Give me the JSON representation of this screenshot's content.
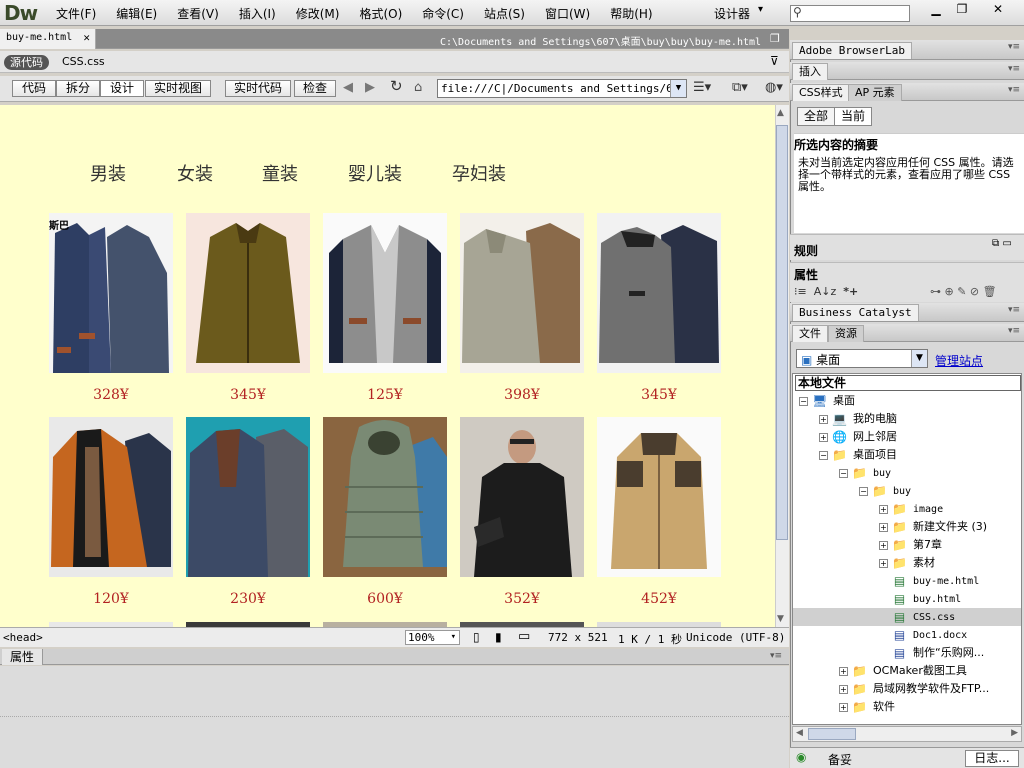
{
  "app": {
    "logo": "Dw",
    "designer": "设计器"
  },
  "menu": [
    "文件(F)",
    "编辑(E)",
    "查看(V)",
    "插入(I)",
    "修改(M)",
    "格式(O)",
    "命令(C)",
    "站点(S)",
    "窗口(W)",
    "帮助(H)"
  ],
  "document": {
    "tab": "buy-me.html",
    "path": "C:\\Documents and Settings\\607\\桌面\\buy\\buy\\buy-me.html",
    "source_code": "源代码",
    "related_file": "CSS.css"
  },
  "toolbar": {
    "code": "代码",
    "split": "拆分",
    "design": "设计",
    "live_view": "实时视图",
    "live_code": "实时代码",
    "inspect": "检查",
    "url": "file:///C|/Documents and Settings/607/"
  },
  "page": {
    "categories": [
      "男装",
      "女装",
      "童装",
      "婴儿装",
      "孕妇装"
    ],
    "row1_prices": [
      "328¥",
      "345¥",
      "125¥",
      "398¥",
      "345¥"
    ],
    "row2_prices": [
      "120¥",
      "230¥",
      "600¥",
      "352¥",
      "452¥"
    ],
    "corner_text": "斯巴"
  },
  "status": {
    "tag": "<head>",
    "zoom": "100%",
    "size": "772 x 521",
    "download": "1 K / 1 秒",
    "encoding": "Unicode (UTF-8)"
  },
  "properties_panel": {
    "tab": "属性"
  },
  "panels": {
    "browserlab": "Adobe BrowserLab",
    "insert": "插入",
    "css_tab": "CSS样式",
    "ap_tab": "AP 元素",
    "all": "全部",
    "current": "当前",
    "summary_title": "所选内容的摘要",
    "summary_text": "未对当前选定内容应用任何 CSS 属性。请选择一个带样式的元素，查看应用了哪些 CSS 属性。",
    "rules": "规则",
    "properties": "属性",
    "business_catalyst": "Business Catalyst",
    "files_tab": "文件",
    "assets_tab": "资源",
    "site": "桌面",
    "manage_sites": "管理站点",
    "local_files": "本地文件",
    "log": "日志...",
    "ready": "备妥"
  },
  "tree": [
    {
      "label": "桌面",
      "level": 0,
      "exp": "-",
      "icon": "desktop"
    },
    {
      "label": "我的电脑",
      "level": 1,
      "exp": "+",
      "icon": "computer"
    },
    {
      "label": "网上邻居",
      "level": 1,
      "exp": "+",
      "icon": "network"
    },
    {
      "label": "桌面项目",
      "level": 1,
      "exp": "-",
      "icon": "folder"
    },
    {
      "label": "buy",
      "level": 2,
      "exp": "-",
      "icon": "folder"
    },
    {
      "label": "buy",
      "level": 3,
      "exp": "-",
      "icon": "folder"
    },
    {
      "label": "image",
      "level": 4,
      "exp": "+",
      "icon": "folder"
    },
    {
      "label": "新建文件夹 (3)",
      "level": 4,
      "exp": "+",
      "icon": "folder"
    },
    {
      "label": "第7章",
      "level": 4,
      "exp": "+",
      "icon": "folder"
    },
    {
      "label": "素材",
      "level": 4,
      "exp": "+",
      "icon": "folder"
    },
    {
      "label": "buy-me.html",
      "level": 4,
      "exp": "",
      "icon": "html"
    },
    {
      "label": "buy.html",
      "level": 4,
      "exp": "",
      "icon": "html"
    },
    {
      "label": "CSS.css",
      "level": 4,
      "exp": "",
      "icon": "css",
      "selected": true
    },
    {
      "label": "Doc1.docx",
      "level": 4,
      "exp": "",
      "icon": "doc"
    },
    {
      "label": "制作“乐购网...",
      "level": 4,
      "exp": "",
      "icon": "doc"
    },
    {
      "label": "OCMaker截图工具",
      "level": 2,
      "exp": "+",
      "icon": "folder"
    },
    {
      "label": "局域网教学软件及FTP...",
      "level": 2,
      "exp": "+",
      "icon": "folder"
    },
    {
      "label": "软件",
      "level": 2,
      "exp": "+",
      "icon": "folder"
    }
  ],
  "colors": {
    "design_bg": "#ffffcc",
    "price": "#b22222"
  }
}
